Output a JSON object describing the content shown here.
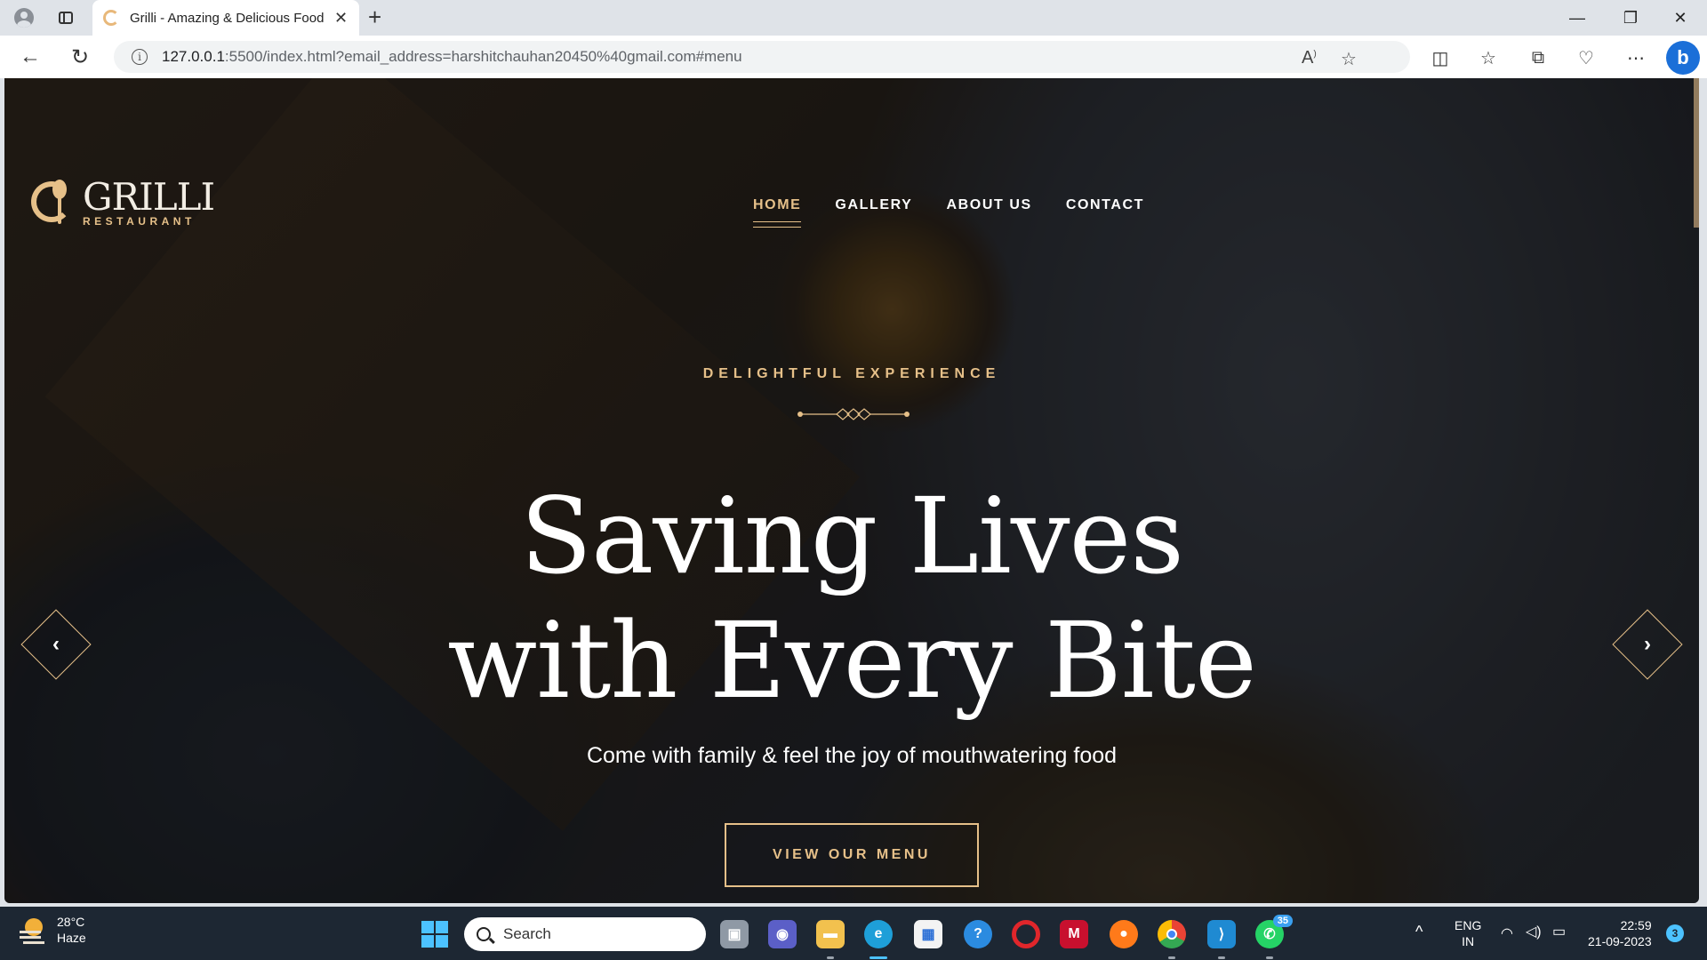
{
  "browser": {
    "tab_title": "Grilli - Amazing & Delicious Food",
    "url_host": "127.0.0.1",
    "url_rest": ":5500/index.html?email_address=harshitchauhan20450%40gmail.com#menu"
  },
  "site": {
    "logo_name": "GRILLI",
    "logo_sub": "RESTAURANT",
    "nav": [
      {
        "label": "HOME",
        "active": true
      },
      {
        "label": "GALLERY",
        "active": false
      },
      {
        "label": "ABOUT US",
        "active": false
      },
      {
        "label": "CONTACT",
        "active": false
      }
    ],
    "hero": {
      "eyebrow": "DELIGHTFUL EXPERIENCE",
      "title_line1": "Saving Lives",
      "title_line2": "with Every Bite",
      "text": "Come with family & feel the joy of mouthwatering food",
      "cta": "VIEW OUR MENU"
    },
    "accent_color": "#e6c089"
  },
  "taskbar": {
    "weather_temp": "28°C",
    "weather_desc": "Haze",
    "search_label": "Search",
    "whatsapp_badge": "35",
    "lang_1": "ENG",
    "lang_2": "IN",
    "time": "22:59",
    "date": "21-09-2023",
    "notifications": "3"
  }
}
